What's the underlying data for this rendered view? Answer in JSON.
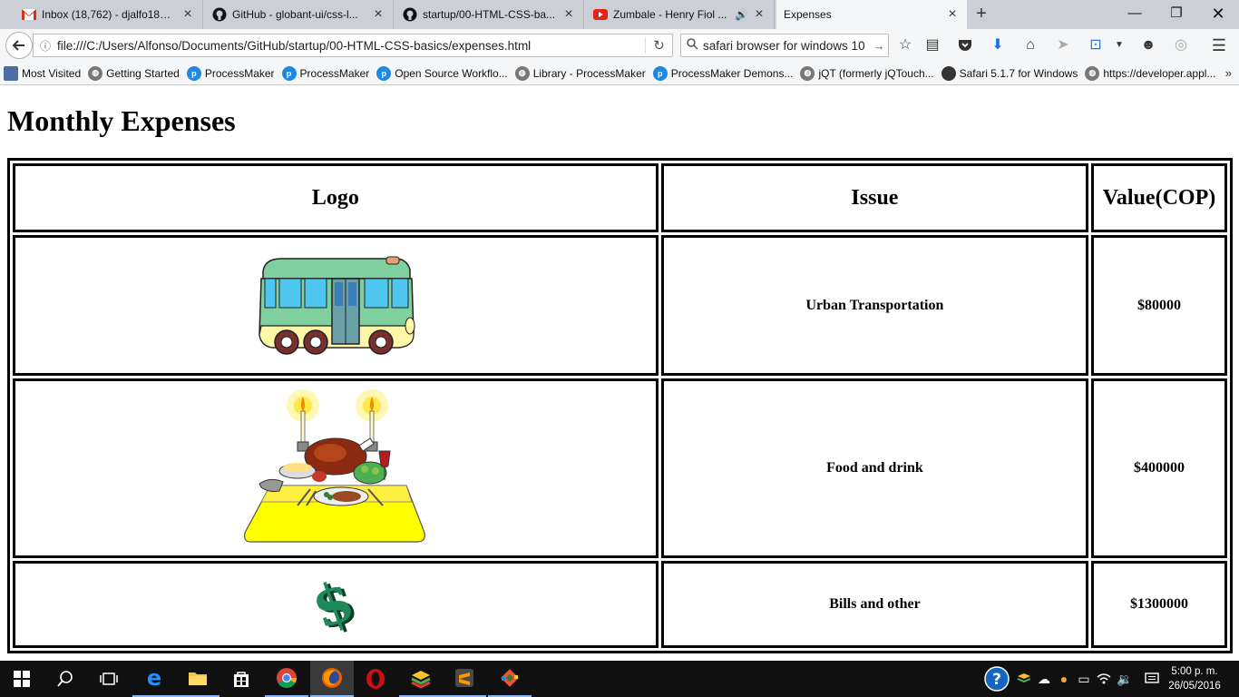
{
  "browser": {
    "tabs": [
      {
        "title": "Inbox (18,762) - djalfo18@...",
        "icon": "gmail-icon"
      },
      {
        "title": "GitHub - globant-ui/css-l...",
        "icon": "github-icon"
      },
      {
        "title": "startup/00-HTML-CSS-ba...",
        "icon": "github-icon"
      },
      {
        "title": "Zumbale - Henry Fiol ...",
        "icon": "youtube-icon"
      },
      {
        "title": "Expenses",
        "icon": "none",
        "active": true
      }
    ],
    "url": "file:///C:/Users/Alfonso/Documents/GitHub/startup/00-HTML-CSS-basics/expenses.html",
    "search_text": "safari browser for windows 10",
    "bookmarks": [
      "Most Visited",
      "Getting Started",
      "ProcessMaker",
      "ProcessMaker",
      "Open Source Workflo...",
      "Library - ProcessMaker",
      "ProcessMaker Demons...",
      "jQT (formerly jQTouch...",
      "Safari 5.1.7 for Windows",
      "https://developer.appl..."
    ]
  },
  "page": {
    "title": "Monthly Expenses",
    "table": {
      "headers": [
        "Logo",
        "Issue",
        "Value(COP)"
      ],
      "rows": [
        {
          "logo": "bus-illustration",
          "issue": "Urban Transportation",
          "value": "$80000"
        },
        {
          "logo": "dinner-table-illustration",
          "issue": "Food and drink",
          "value": "$400000"
        },
        {
          "logo": "dollar-sign-illustration",
          "issue": "Bills and other",
          "value": "$1300000"
        }
      ]
    }
  },
  "taskbar": {
    "time": "5:00 p. m.",
    "date": "26/05/2016"
  },
  "colors": {
    "tabbar": "#ccd0d6",
    "toolbar": "#f5f6f7",
    "taskbar": "#101010",
    "bus_body": "#7fcf9f",
    "table_yellow": "#ffff00",
    "dollar_green": "#1e8a5a"
  }
}
